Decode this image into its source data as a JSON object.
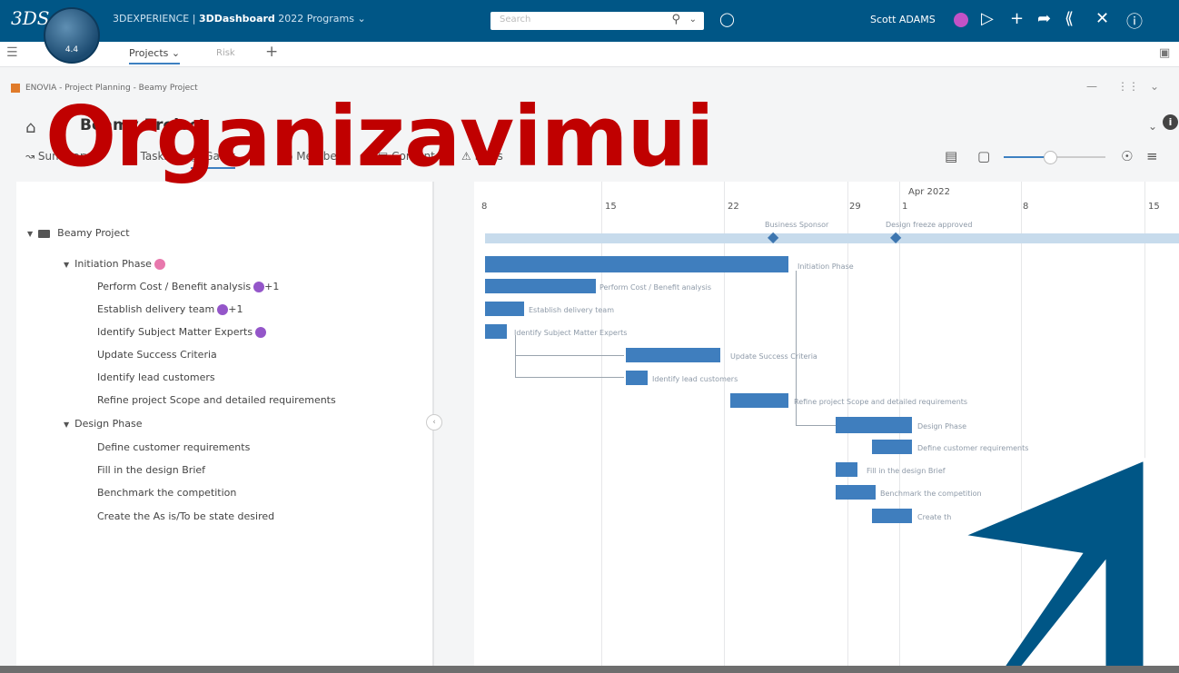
{
  "topbar": {
    "brand_logo": "3DS",
    "compass_version": "4.4",
    "app_title_prefix": "3DEXPERIENCE | ",
    "app_title_main": "3DDashboard",
    "app_title_suffix": " 2022 Programs",
    "search_placeholder": "Search",
    "user_name": "Scott ADAMS",
    "icons": [
      "search-icon",
      "tag-icon",
      "play-icon",
      "plus-icon",
      "share-icon",
      "network-icon",
      "tools-icon",
      "help-icon"
    ]
  },
  "tabs": {
    "projects_label": "Projects",
    "risk_label": "Risk",
    "add_label": "+"
  },
  "breadcrumb": "ENOVIA - Project Planning - Beamy Project",
  "header": {
    "project_title": "Beamy Project"
  },
  "view_tabs": [
    {
      "label": "Summary"
    },
    {
      "label": "Tasks"
    },
    {
      "label": "Gantt"
    },
    {
      "label": "Members"
    },
    {
      "label": "Content"
    },
    {
      "label": "Risks"
    }
  ],
  "gantt_scale": {
    "month_label": "Apr 2022",
    "day_labels": [
      "8",
      "15",
      "22",
      "29",
      "1",
      "8",
      "15"
    ],
    "zoom_level": 0.45
  },
  "tasks": [
    {
      "name": "Beamy Project",
      "level": 0,
      "expanded": true
    },
    {
      "name": "Initiation Phase",
      "level": 1,
      "expanded": true,
      "badge": "pink"
    },
    {
      "name": "Perform Cost / Benefit analysis",
      "level": 2,
      "badge": "purple",
      "extra": "+1"
    },
    {
      "name": "Establish delivery team",
      "level": 2,
      "badge": "purple",
      "extra": "+1"
    },
    {
      "name": "Identify Subject Matter Experts",
      "level": 2,
      "badge": "purple"
    },
    {
      "name": "Update Success Criteria",
      "level": 2
    },
    {
      "name": "Identify lead customers",
      "level": 2
    },
    {
      "name": "Refine project Scope and detailed requirements",
      "level": 2
    },
    {
      "name": "Design Phase",
      "level": 1,
      "expanded": true
    },
    {
      "name": "Define customer requirements",
      "level": 2
    },
    {
      "name": "Fill in the design Brief",
      "level": 2
    },
    {
      "name": "Benchmark the competition",
      "level": 2
    },
    {
      "name": "Create the As is/To be state desired",
      "level": 2
    }
  ],
  "bar_labels": {
    "initiation": "Initiation Phase",
    "cost": "Perform Cost / Benefit analysis",
    "delivery": "Establish delivery team",
    "sme": "Identify Subject Matter Experts",
    "success": "Update Success Criteria",
    "lead": "Identify lead customers",
    "refine": "Refine project Scope and detailed requirements",
    "design": "Design Phase",
    "define": "Define customer requirements",
    "brief": "Fill in the design Brief",
    "bench": "Benchmark the competition",
    "create": "Create th"
  },
  "milestones": {
    "m1": "Business Sponsor",
    "m2": "Design freeze approved"
  },
  "overlay_text": "Organizavimui",
  "colors": {
    "topbar": "#005686",
    "bar": "#3f7ebe",
    "overlay": "#c00000",
    "arrow": "#005686"
  }
}
